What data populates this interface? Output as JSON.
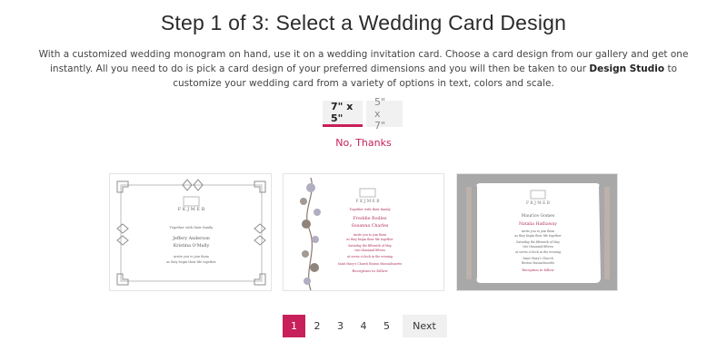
{
  "heading": "Step 1 of 3: Select a Wedding Card Design",
  "intro": {
    "part1": "With a customized wedding monogram on hand, use it on a wedding invitation card. Choose a card design from our gallery and get one instantly. All you need to do is pick a card design of your preferred dimensions and you will then be taken to our ",
    "link": "Design Studio",
    "part2": " to customize your wedding card from a variety of options in text, colors and scale."
  },
  "size_tabs": [
    {
      "label": "7\" x 5\"",
      "selected": true
    },
    {
      "label": "5\" x 7\"",
      "selected": false
    }
  ],
  "no_thanks": "No, Thanks",
  "cards": [
    {
      "monogram": "F K J M E B",
      "lines": [
        "Together with their family",
        "Jeffery Anderson",
        "Kristina O'Mally",
        "invite you to join them",
        "as they begin their life together"
      ]
    },
    {
      "monogram": "F K J M E B",
      "lines": [
        "Together with their family",
        "Freddie Rodles",
        "Susanna Charles",
        "invite you to join them",
        "as they begin their life together",
        "Saturday the fifteenth of May",
        "two thousand fifteen",
        "at seven o'clock in the evening",
        "Saint Mary's Church Boston Massachusetts",
        "Reception to follow"
      ]
    },
    {
      "monogram": "F K J M E B",
      "lines": [
        "Maurice Gomes",
        "Natalia Hathaway",
        "invite you to join them",
        "as they begin their life together",
        "Saturday the fifteenth of May",
        "two thousand fifteen",
        "at seven o'clock in the evening",
        "Saint Mary's Church",
        "Boston Massachusetts",
        "Reception to follow"
      ]
    }
  ],
  "pagination": {
    "pages": [
      "1",
      "2",
      "3",
      "4",
      "5"
    ],
    "current": "1",
    "next": "Next"
  },
  "colors": {
    "accent": "#c8205a",
    "card_text": "#b03060",
    "ornament": "#9a9a9a",
    "card3_background": "#a8a8a8"
  }
}
